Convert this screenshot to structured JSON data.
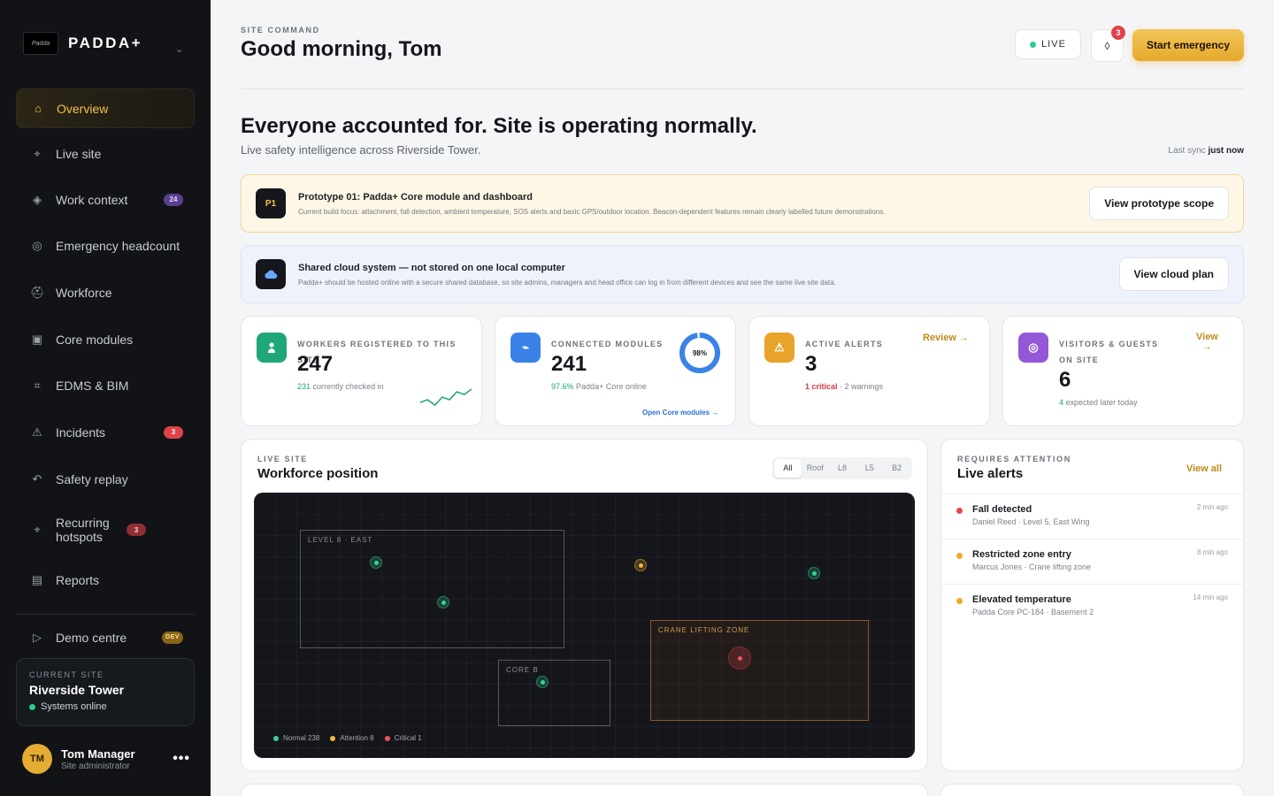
{
  "brand": {
    "logo_text": "Padda",
    "name": "PADDA+"
  },
  "nav": {
    "items": [
      {
        "label": "Overview",
        "icon": "home-icon",
        "glyph": "⌂"
      },
      {
        "label": "Live site",
        "icon": "location-icon",
        "glyph": "⌖"
      },
      {
        "label": "Work context",
        "icon": "layers-icon",
        "glyph": "◈",
        "badge": "24"
      },
      {
        "label": "Emergency headcount",
        "icon": "target-icon",
        "glyph": "◎"
      },
      {
        "label": "Workforce",
        "icon": "helmet-icon",
        "glyph": "⛑"
      },
      {
        "label": "Core modules",
        "icon": "module-icon",
        "glyph": "▣"
      },
      {
        "label": "EDMS & BIM",
        "icon": "grid-icon",
        "glyph": "⌗"
      },
      {
        "label": "Incidents",
        "icon": "warning-icon",
        "glyph": "⚠",
        "badge": "3"
      },
      {
        "label": "Safety replay",
        "icon": "replay-icon",
        "glyph": "↶"
      },
      {
        "label": "Recurring hotspots",
        "icon": "hotspot-icon",
        "glyph": "⌖",
        "badge": "3"
      },
      {
        "label": "Reports",
        "icon": "report-icon",
        "glyph": "▤"
      },
      {
        "label": "Demo centre",
        "icon": "play-icon",
        "glyph": "▷",
        "badge": "DEV"
      }
    ]
  },
  "current_site": {
    "kicker": "CURRENT SITE",
    "name": "Riverside Tower",
    "status": "Systems online",
    "status_color": "#2ecc8a"
  },
  "user": {
    "initials": "TM",
    "name": "Tom Manager",
    "role": "Site administrator",
    "more": "•••"
  },
  "header": {
    "kicker": "SITE COMMAND",
    "title": "Good morning, Tom",
    "live_label": "LIVE",
    "notifications_count": "3",
    "bell_glyph": "◊",
    "emergency_label": "Start emergency"
  },
  "status": {
    "headline": "Everyone accounted for. Site is operating normally.",
    "sub": "Live safety intelligence across Riverside Tower.",
    "sync_label": "Last sync",
    "sync_value": "just now"
  },
  "banners": {
    "prototype": {
      "icon_text": "P1",
      "title": "Prototype 01: Padda+ Core module and dashboard",
      "desc": "Current build focus: attachment, fall detection, ambient temperature, SOS alerts and basic GPS/outdoor location. Beacon-dependent features remain clearly labelled future demonstrations.",
      "button": "View prototype scope"
    },
    "cloud": {
      "title": "Shared cloud system — not stored on one local computer",
      "desc": "Padda+ should be hosted online with a secure shared database, so site admins, managers and head office can log in from different devices and see the same live site data.",
      "button": "View cloud plan"
    }
  },
  "stats": {
    "workers": {
      "label": "WORKERS REGISTERED TO THIS SITE",
      "value": "247",
      "sub_value": "231",
      "sub_text": "currently checked in",
      "sparkline": [
        4,
        5,
        3,
        6,
        5,
        8,
        7,
        9
      ]
    },
    "modules": {
      "label": "CONNECTED MODULES",
      "value": "241",
      "sub_value": "97.6%",
      "sub_text": "Padda+ Core online",
      "donut_label": "98%",
      "donut_fraction": 0.976,
      "link": "Open Core modules →"
    },
    "alerts": {
      "label": "ACTIVE ALERTS",
      "value": "3",
      "critical": "1 critical",
      "sep": " · ",
      "warnings": "2 warnings",
      "link": "Review →"
    },
    "visitors": {
      "label": "VISITORS & GUESTS ON SITE",
      "value": "6",
      "sub_value": "4",
      "sub_text": "expected later today",
      "link_1": "View",
      "link_2": "→"
    }
  },
  "live_site": {
    "kicker": "LIVE SITE",
    "title": "Workforce position",
    "filters": [
      "All",
      "Roof",
      "L8",
      "L5",
      "B2"
    ],
    "zones": {
      "level8": "LEVEL 8 · EAST",
      "core": "CORE B",
      "crane": "CRANE LIFTING ZONE"
    },
    "legend": {
      "normal": "Normal 238",
      "attention": "Attention 8",
      "critical": "Critical 1"
    }
  },
  "alerts_panel": {
    "kicker": "REQUIRES ATTENTION",
    "title": "Live alerts",
    "view_all": "View all",
    "items": [
      {
        "title": "Fall detected",
        "detail": "Daniel Reed · Level 5, East Wing",
        "time": "2 min ago",
        "color": "#e5484d"
      },
      {
        "title": "Restricted zone entry",
        "detail": "Marcus Jones · Crane lifting zone",
        "time": "8 min ago",
        "color": "#f0a928"
      },
      {
        "title": "Elevated temperature",
        "detail": "Padda Core PC-184 · Basement 2",
        "time": "14 min ago",
        "color": "#f0a928"
      }
    ]
  }
}
